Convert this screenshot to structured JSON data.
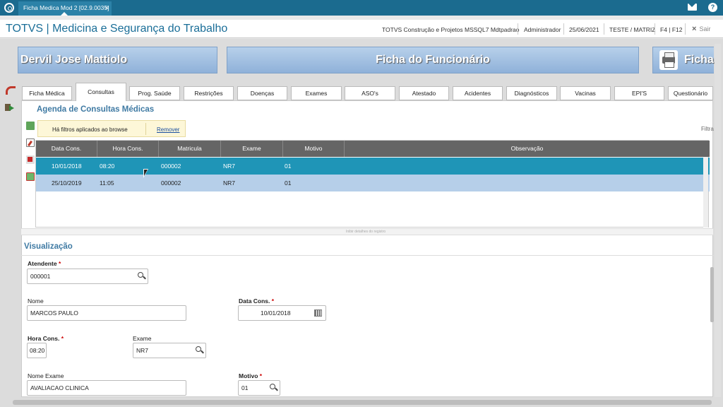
{
  "window_tab": {
    "title": "Ficha Medica Mod 2 [02.9.0035]",
    "close": "×"
  },
  "app": {
    "title": "TOTVS | Medicina e Segurança do Trabalho",
    "company": "TOTVS Construção e Projetos MSSQL7 Mdtpadrao",
    "user": "Administrador",
    "date": "25/06/2021",
    "branch": "TESTE / MATRIZ",
    "shortcut": "F4 | F12",
    "exit_label": "Sair",
    "exit_icon": "×"
  },
  "header": {
    "employee_name": "Dervil Jose Mattiolo",
    "form_title": "Ficha do Funcionário",
    "print_label": "Ficha"
  },
  "tabs": [
    {
      "label": "Ficha Médica"
    },
    {
      "label": "Consultas",
      "active": true
    },
    {
      "label": "Prog. Saúde"
    },
    {
      "label": "Restrições"
    },
    {
      "label": "Doenças"
    },
    {
      "label": "Exames"
    },
    {
      "label": "ASO's"
    },
    {
      "label": "Atestado"
    },
    {
      "label": "Acidentes"
    },
    {
      "label": "Diagnósticos"
    },
    {
      "label": "Vacinas"
    },
    {
      "label": "EPI'S"
    },
    {
      "label": "Questionário"
    }
  ],
  "agenda": {
    "title": "Agenda de Consultas Médicas",
    "filter_text": "Há filtros aplicados ao browse",
    "remove_link": "Remover",
    "filter_button": "Filtra",
    "columns": [
      "Data Cons.",
      "Hora Cons.",
      "Matricula",
      "Exame",
      "Motivo",
      "Observação"
    ],
    "rows": [
      {
        "date": "10/01/2018",
        "time": "08:20",
        "registration": "000002",
        "exam": "NR7",
        "reason": "01",
        "note": "",
        "selected": true
      },
      {
        "date": "25/10/2019",
        "time": "11:05",
        "registration": "000002",
        "exam": "NR7",
        "reason": "01",
        "note": ""
      }
    ],
    "splitter_hint": "Inibir detalhes do registro"
  },
  "view": {
    "title": "Visualização",
    "attendant": {
      "label": "Atendente",
      "required": "*",
      "value": "000001"
    },
    "name": {
      "label": "Nome",
      "value": "MARCOS PAULO"
    },
    "consult_date": {
      "label": "Data Cons.",
      "required": "*",
      "value": "10/01/2018"
    },
    "consult_time": {
      "label": "Hora Cons.",
      "required": "*",
      "value": "08:20"
    },
    "exam": {
      "label": "Exame",
      "value": "NR7"
    },
    "exam_name": {
      "label": "Nome Exame",
      "value": "AVALIACAO CLINICA"
    },
    "reason": {
      "label": "Motivo",
      "required": "*",
      "value": "01"
    }
  },
  "colors": {
    "topbar": "#1b6b8f",
    "accent": "#1a6e98",
    "selected_row": "#1f95b7",
    "second_row": "#b6cfe9",
    "grid_header": "#656565"
  },
  "icons": [
    "totvs-logo-icon",
    "mail-icon",
    "help-icon",
    "close-icon",
    "printer-icon",
    "undo-icon",
    "exit-icon",
    "add-record-icon",
    "edit-record-icon",
    "delete-record-icon",
    "refresh-record-icon",
    "search-icon",
    "calendar-icon"
  ]
}
